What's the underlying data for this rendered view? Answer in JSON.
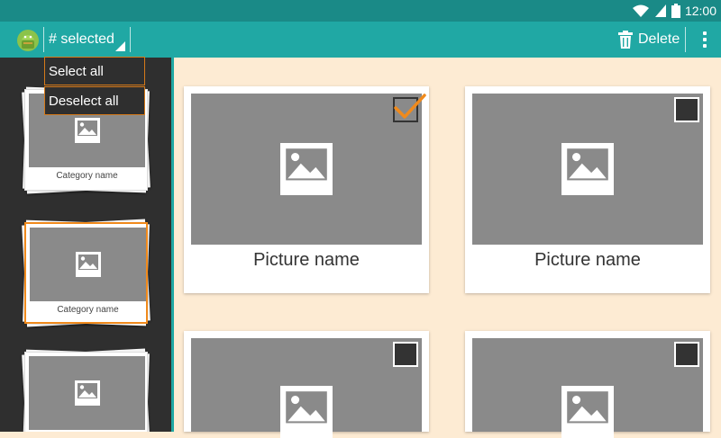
{
  "status_bar": {
    "time": "12:00",
    "icons": [
      "wifi-icon",
      "signal-icon",
      "battery-icon"
    ],
    "background": "#1a8a87"
  },
  "action_bar": {
    "background": "#20a8a4",
    "logo_icon": "android-icon",
    "selection_label": "# selected",
    "delete_label": "Delete",
    "delete_icon": "trash-icon",
    "overflow_icon": "more-vert-icon"
  },
  "selection_menu": {
    "items": [
      {
        "label": "Select all"
      },
      {
        "label": "Deselect all"
      }
    ]
  },
  "sidebar": {
    "categories": [
      {
        "label": "Category name",
        "selected": false
      },
      {
        "label": "Category name",
        "selected": true
      },
      {
        "label": "",
        "selected": false
      }
    ]
  },
  "pictures": [
    {
      "name": "Picture name",
      "checked": true
    },
    {
      "name": "Picture name",
      "checked": false
    },
    {
      "name": "",
      "checked": false
    },
    {
      "name": "",
      "checked": false
    }
  ],
  "colors": {
    "accent": "#f08a1c",
    "background": "#fdebd3",
    "sidebar": "#2f2f2f",
    "thumbnail": "#8a8a8a"
  }
}
